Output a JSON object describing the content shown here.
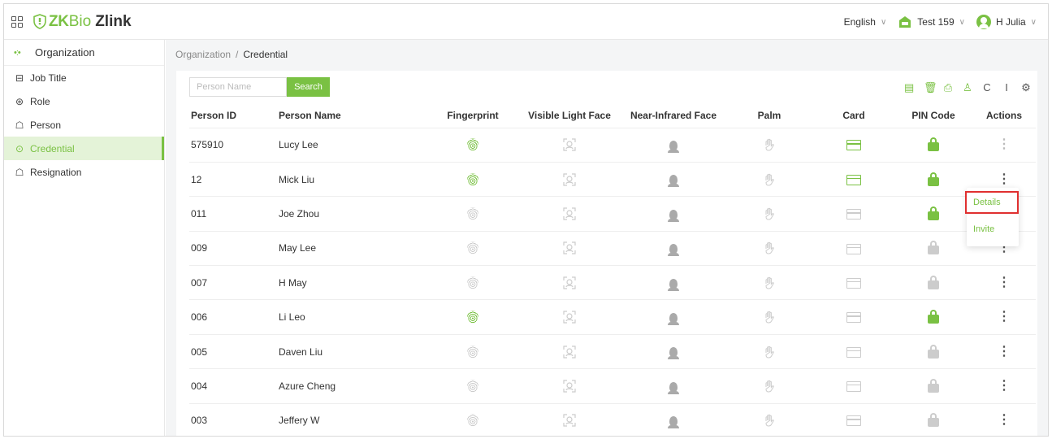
{
  "header": {
    "brand_zk": "ZK",
    "brand_bio": "Bio",
    "brand_app": "Zlink",
    "language": "English",
    "company": "Test 159",
    "user": "H Julia"
  },
  "sidebar": {
    "title": "Organization",
    "items": [
      {
        "label": "Job Title",
        "icon": "briefcase-icon"
      },
      {
        "label": "Role",
        "icon": "role-icon"
      },
      {
        "label": "Person",
        "icon": "person-icon"
      },
      {
        "label": "Credential",
        "icon": "credential-icon",
        "active": true
      },
      {
        "label": "Resignation",
        "icon": "resignation-icon"
      }
    ]
  },
  "breadcrumb": {
    "parent": "Organization",
    "separator": "/",
    "current": "Credential"
  },
  "search": {
    "placeholder": "Person Name",
    "button": "Search"
  },
  "table": {
    "columns": [
      "Person ID",
      "Person Name",
      "Fingerprint",
      "Visible Light Face",
      "Near-Infrared Face",
      "Palm",
      "Card",
      "PIN Code",
      "Actions"
    ],
    "rows": [
      {
        "id": "575910",
        "name": "Lucy Lee",
        "fingerprint": true,
        "card": true,
        "pin": true
      },
      {
        "id": "12",
        "name": "Mick Liu",
        "fingerprint": true,
        "card": true,
        "pin": true
      },
      {
        "id": "011",
        "name": "Joe Zhou",
        "fingerprint": false,
        "card": false,
        "pin": true
      },
      {
        "id": "009",
        "name": "May Lee",
        "fingerprint": false,
        "card": false,
        "pin": false
      },
      {
        "id": "007",
        "name": "H May",
        "fingerprint": false,
        "card": false,
        "pin": false
      },
      {
        "id": "006",
        "name": "Li Leo",
        "fingerprint": true,
        "card": false,
        "pin": true
      },
      {
        "id": "005",
        "name": "Daven Liu",
        "fingerprint": false,
        "card": false,
        "pin": false
      },
      {
        "id": "004",
        "name": "Azure Cheng",
        "fingerprint": false,
        "card": false,
        "pin": false
      },
      {
        "id": "003",
        "name": "Jeffery W",
        "fingerprint": false,
        "card": false,
        "pin": false
      }
    ]
  },
  "actions_menu": {
    "details": "Details",
    "invite": "Invite"
  },
  "colors": {
    "accent": "#7ac143",
    "inactive": "#cccccc",
    "highlight_border": "#e03030"
  }
}
